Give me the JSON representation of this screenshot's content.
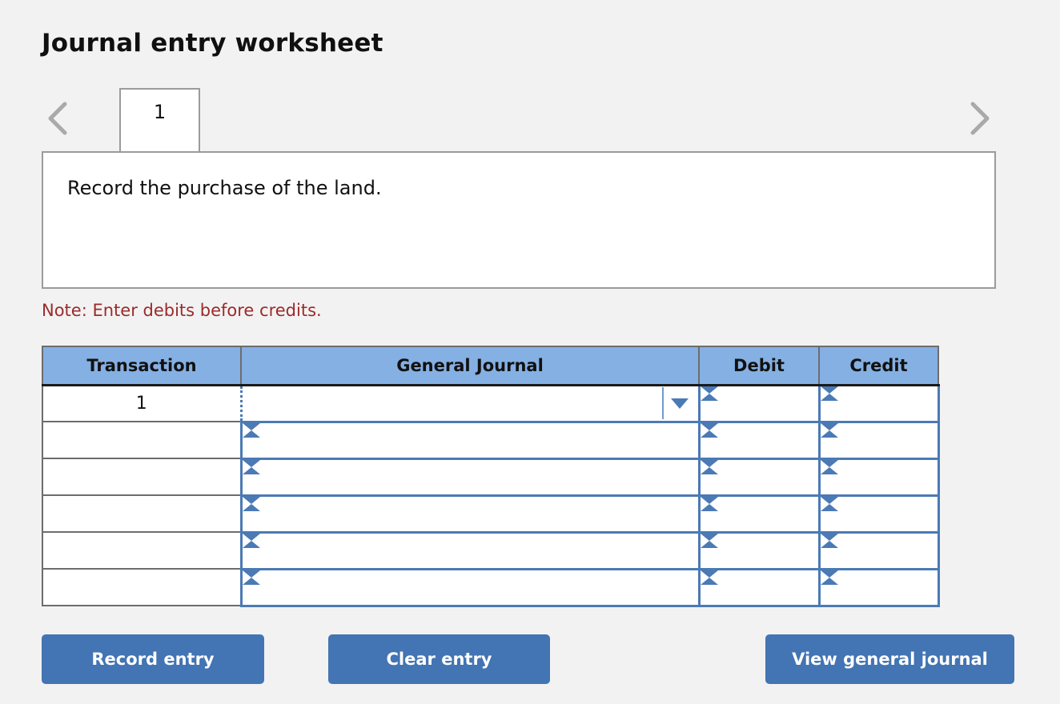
{
  "page_title": "Journal entry worksheet",
  "tabs": {
    "prev_icon": "chevron-left-icon",
    "next_icon": "chevron-right-icon",
    "items": [
      {
        "label": "1",
        "active": true
      }
    ]
  },
  "instruction": {
    "text": "Record the purchase of the land."
  },
  "note": {
    "text": "Note: Enter debits before credits.",
    "color": "#9c2a2a"
  },
  "table": {
    "headers": [
      "Transaction",
      "General Journal",
      "Debit",
      "Credit"
    ],
    "rows": [
      {
        "transaction": "1",
        "general_journal": "",
        "debit": "",
        "credit": "",
        "selected": true
      },
      {
        "transaction": "",
        "general_journal": "",
        "debit": "",
        "credit": "",
        "selected": false
      },
      {
        "transaction": "",
        "general_journal": "",
        "debit": "",
        "credit": "",
        "selected": false
      },
      {
        "transaction": "",
        "general_journal": "",
        "debit": "",
        "credit": "",
        "selected": false
      },
      {
        "transaction": "",
        "general_journal": "",
        "debit": "",
        "credit": "",
        "selected": false
      },
      {
        "transaction": "",
        "general_journal": "",
        "debit": "",
        "credit": "",
        "selected": false
      }
    ],
    "header_bg": "#85b0e3",
    "cell_border": "#4b7ab5"
  },
  "buttons": {
    "record": "Record entry",
    "clear": "Clear entry",
    "view": "View general journal",
    "color": "#4374b3"
  }
}
